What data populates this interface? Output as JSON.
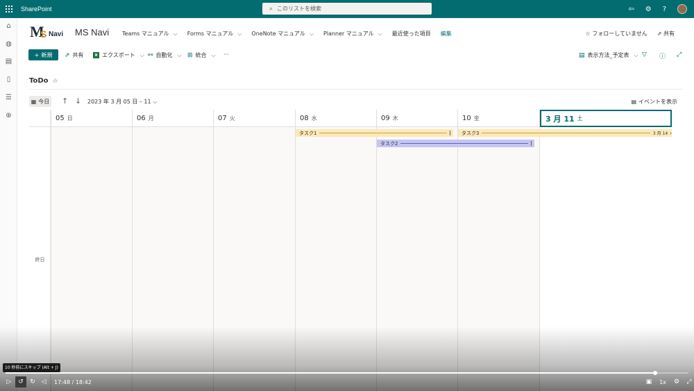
{
  "suitebar": {
    "app_name": "SharePoint",
    "search_placeholder": "このリストを検索"
  },
  "site": {
    "logo_text": "MSNavi",
    "name": "MS Navi",
    "nav": [
      {
        "label": "Teams マニュアル"
      },
      {
        "label": "Forms マニュアル"
      },
      {
        "label": "OneNote マニュアル"
      },
      {
        "label": "Planner マニュアル"
      },
      {
        "label": "最近使った項目"
      },
      {
        "label": "編集"
      }
    ],
    "follow_label": "フォローしていません",
    "share_label": "共有"
  },
  "commandbar": {
    "new_label": "新規",
    "share_label": "共有",
    "export_label": "エクスポート",
    "automate_label": "自動化",
    "integrate_label": "統合",
    "more_label": "···",
    "view_label": "表示方法_予定表"
  },
  "list": {
    "title": "ToDo",
    "today_label": "今日",
    "date_range": "2023 年 3 月 05 日 – 11",
    "show_events_label": "イベントを表示"
  },
  "calendar": {
    "allday_label": "終日",
    "days": [
      {
        "date": "05",
        "dow": "日"
      },
      {
        "date": "06",
        "dow": "月"
      },
      {
        "date": "07",
        "dow": "火"
      },
      {
        "date": "08",
        "dow": "水"
      },
      {
        "date": "09",
        "dow": "木"
      },
      {
        "date": "10",
        "dow": "金"
      },
      {
        "date": "3 月 11",
        "dow": "土"
      }
    ],
    "events": [
      {
        "title": "タスク1",
        "color": "#fde9b8"
      },
      {
        "title": "タスク2",
        "color": "#c5c6f3"
      },
      {
        "title": "タスク3",
        "end_label": "3 月 14",
        "color": "#fde9b8"
      }
    ]
  },
  "video": {
    "tooltip": "10 秒前にスキップ (Alt + J)",
    "time": "17:48 / 18:42",
    "progress_fraction": 0.951,
    "speed": "1x"
  },
  "colors": {
    "suitebar": "#036c70",
    "accent": "#036c70"
  }
}
